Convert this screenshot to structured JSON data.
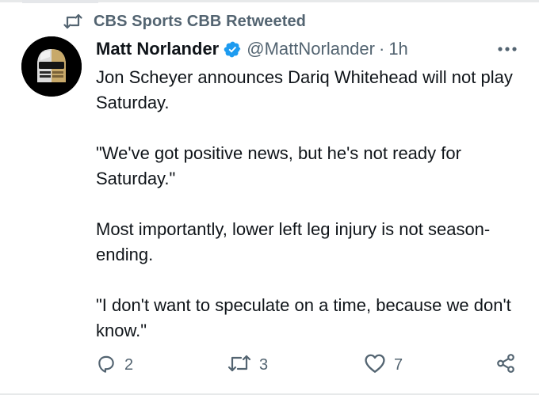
{
  "retweet_context": {
    "icon": "retweet-icon",
    "text": "CBS Sports CBB Retweeted"
  },
  "author": {
    "name": "Matt Norlander",
    "verified_icon": "verified-badge-icon",
    "handle": "@MattNorlander",
    "separator": "·",
    "time": "1h"
  },
  "tweet": {
    "paragraphs": [
      "Jon Scheyer announces Dariq Whitehead will not play Saturday.",
      "\"We've got positive news, but he's not ready for Saturday.\"",
      "Most importantly, lower left leg injury is not season-ending.",
      "\"I don't want to speculate on a time, because we don't know.\""
    ]
  },
  "actions": {
    "reply": {
      "icon": "reply-icon",
      "count": "2"
    },
    "retweet": {
      "icon": "retweet-icon",
      "count": "3"
    },
    "like": {
      "icon": "heart-icon",
      "count": "7"
    },
    "share": {
      "icon": "share-icon"
    }
  },
  "colors": {
    "text_primary": "#0f1419",
    "text_secondary": "#536471",
    "verified_blue": "#1d9bf0",
    "divider": "#e7e9ea"
  }
}
